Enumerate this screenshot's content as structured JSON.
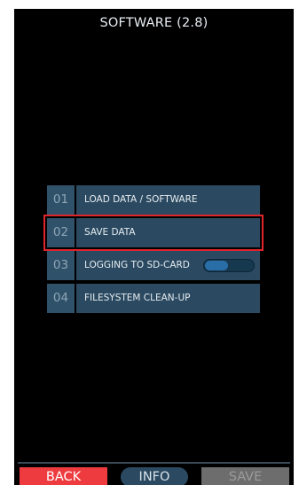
{
  "header": {
    "title": "SOFTWARE (2.8)"
  },
  "menu": {
    "items": [
      {
        "number": "01",
        "label": "LOAD DATA / SOFTWARE",
        "selected": false
      },
      {
        "number": "02",
        "label": "SAVE DATA",
        "selected": true
      },
      {
        "number": "03",
        "label": "LOGGING TO SD-CARD",
        "selected": false,
        "toggle": "off"
      },
      {
        "number": "04",
        "label": "FILESYSTEM CLEAN-UP",
        "selected": false
      }
    ]
  },
  "footer": {
    "back_label": "BACK",
    "info_label": "INFO",
    "save_label": "SAVE",
    "save_enabled": false
  },
  "colors": {
    "screen_background": "#000000",
    "menu_item": "#2b4a61",
    "selection_outline": "#e0242b",
    "back_button": "#ee3b3f",
    "save_button_disabled": "#6d6d6d",
    "toggle_knob": "#2a6ea8"
  }
}
